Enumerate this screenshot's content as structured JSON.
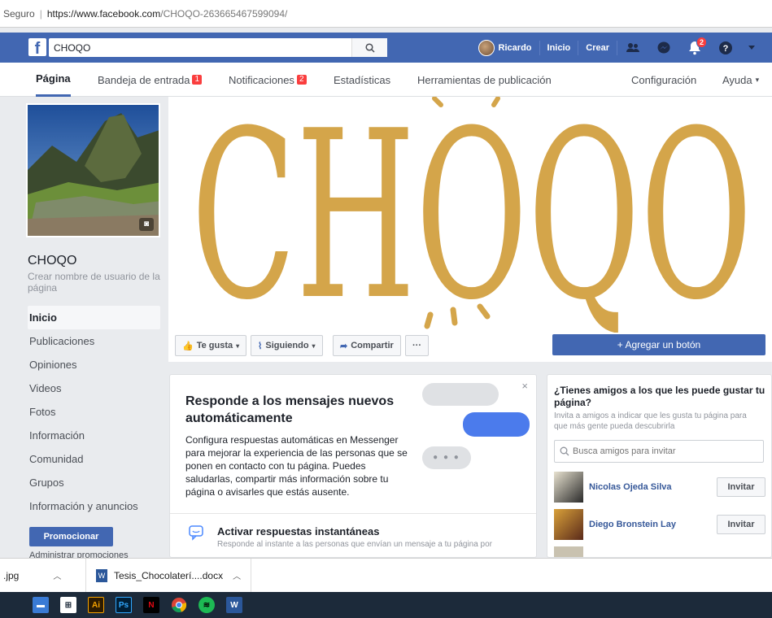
{
  "browser": {
    "secure_label": "Seguro",
    "url_host": "https://www.facebook.com",
    "url_path": "/CHOQO-263665467599094/"
  },
  "topbar": {
    "search_value": "CHOQO",
    "user_name": "Ricardo",
    "home_label": "Inicio",
    "create_label": "Crear",
    "notif_count": "2",
    "brand_color": "#4267b2"
  },
  "page_nav": {
    "tabs": [
      {
        "label": "Página"
      },
      {
        "label": "Bandeja de entrada",
        "count": "1"
      },
      {
        "label": "Notificaciones",
        "count": "2"
      },
      {
        "label": "Estadísticas"
      },
      {
        "label": "Herramientas de publicación"
      }
    ],
    "settings_label": "Configuración",
    "help_label": "Ayuda"
  },
  "sidebar": {
    "page_name": "CHOQO",
    "username_prompt": "Crear nombre de usuario de la página",
    "items": [
      {
        "label": "Inicio"
      },
      {
        "label": "Publicaciones"
      },
      {
        "label": "Opiniones"
      },
      {
        "label": "Videos"
      },
      {
        "label": "Fotos"
      },
      {
        "label": "Información"
      },
      {
        "label": "Comunidad"
      },
      {
        "label": "Grupos"
      },
      {
        "label": "Información y anuncios"
      }
    ],
    "promote_label": "Promocionar",
    "admin_label": "Administrar promociones"
  },
  "cover": {
    "brand_text": "CHOQO",
    "brand_color": "#d4a54a",
    "like_label": "Te gusta",
    "following_label": "Siguiendo",
    "share_label": "Compartir",
    "more_label": "···",
    "add_button_label": "+ Agregar un botón"
  },
  "messenger_card": {
    "title": "Responde a los mensajes nuevos automáticamente",
    "description": "Configura respuestas automáticas en Messenger para mejorar la experiencia de las personas que se ponen en contacto con tu página. Puedes saludarlas, compartir más información sobre tu página o avisarles que estás ausente.",
    "close": "×",
    "instant_title": "Activar respuestas instantáneas",
    "instant_desc": "Responde al instante a las personas que envían un mensaje a tu página por"
  },
  "invite_card": {
    "title": "¿Tienes amigos a los que les puede gustar tu página?",
    "subtitle": "Invita a amigos a indicar que les gusta tu página para que más gente pueda descubrirla",
    "search_placeholder": "Busca amigos para invitar",
    "friends": [
      {
        "name": "Nicolas Ojeda Silva",
        "button": "Invitar"
      },
      {
        "name": "Diego Bronstein Lay",
        "button": "Invitar"
      }
    ]
  },
  "downloads": {
    "item1": ".jpg",
    "item2": "Tesis_Chocolaterí....docx"
  },
  "taskbar": {
    "ai_label": "Ai",
    "ps_label": "Ps",
    "netflix_label": "N",
    "word_label": "W"
  }
}
